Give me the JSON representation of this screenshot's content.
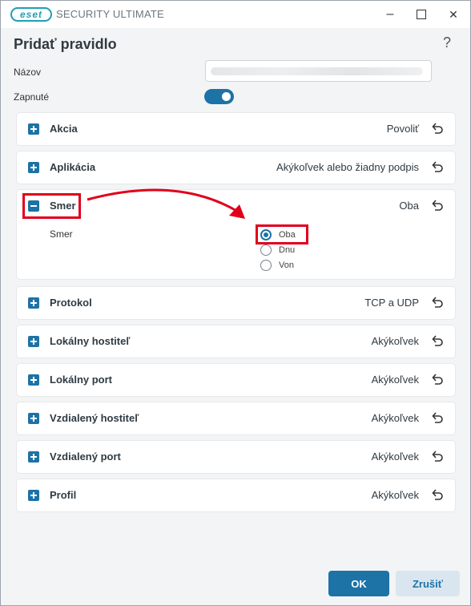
{
  "window": {
    "brand_logo_text": "eset",
    "app_title": "SECURITY ULTIMATE",
    "minimize_label": "–",
    "close_label": "✕"
  },
  "dialog": {
    "title": "Pridať pravidlo",
    "help_label": "?"
  },
  "form": {
    "name_label": "Názov",
    "enabled_label": "Zapnuté",
    "enabled_value": true
  },
  "sections": {
    "action": {
      "title": "Akcia",
      "value": "Povoliť"
    },
    "application": {
      "title": "Aplikácia",
      "value": "Akýkoľvek alebo žiadny podpis"
    },
    "direction": {
      "title": "Smer",
      "value": "Oba",
      "field_label": "Smer",
      "options": [
        {
          "label": "Oba",
          "selected": true
        },
        {
          "label": "Dnu",
          "selected": false
        },
        {
          "label": "Von",
          "selected": false
        }
      ]
    },
    "protocol": {
      "title": "Protokol",
      "value": "TCP a UDP"
    },
    "local_host": {
      "title": "Lokálny hostiteľ",
      "value": "Akýkoľvek"
    },
    "local_port": {
      "title": "Lokálny port",
      "value": "Akýkoľvek"
    },
    "remote_host": {
      "title": "Vzdialený hostiteľ",
      "value": "Akýkoľvek"
    },
    "remote_port": {
      "title": "Vzdialený port",
      "value": "Akýkoľvek"
    },
    "profile": {
      "title": "Profil",
      "value": "Akýkoľvek"
    }
  },
  "footer": {
    "ok_label": "OK",
    "cancel_label": "Zrušiť"
  },
  "colors": {
    "accent": "#1d72a6",
    "highlight": "#e0001a"
  },
  "icons": {
    "expand": "plus-icon",
    "collapse": "minus-icon",
    "reset": "undo-icon"
  }
}
